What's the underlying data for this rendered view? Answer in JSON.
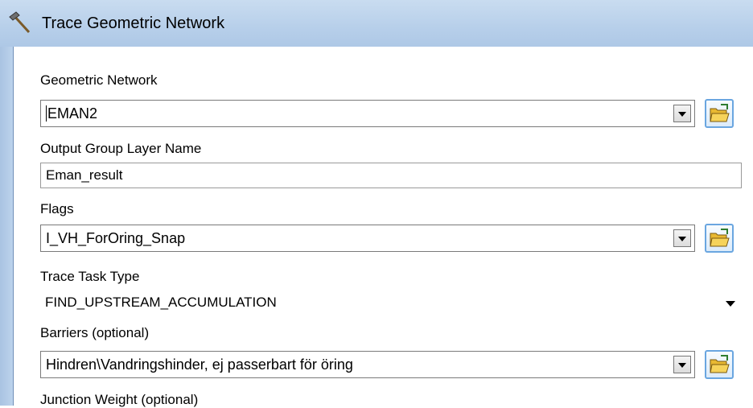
{
  "window": {
    "title": "Trace Geometric Network"
  },
  "form": {
    "geometric_network": {
      "label": "Geometric Network",
      "value": "EMAN2"
    },
    "output_group_layer": {
      "label": "Output Group Layer Name",
      "value": "Eman_result"
    },
    "flags": {
      "label": "Flags",
      "value": "I_VH_ForOring_Snap"
    },
    "trace_task_type": {
      "label": "Trace Task Type",
      "value": "FIND_UPSTREAM_ACCUMULATION"
    },
    "barriers": {
      "label": "Barriers (optional)",
      "value": "Hindren\\Vandringshinder, ej passerbart för öring"
    },
    "junction_weight": {
      "label": "Junction Weight (optional)"
    }
  },
  "icons": {
    "window": "hammer-icon",
    "browse": "open-folder-icon",
    "dropdown": "chevron-down-icon"
  }
}
